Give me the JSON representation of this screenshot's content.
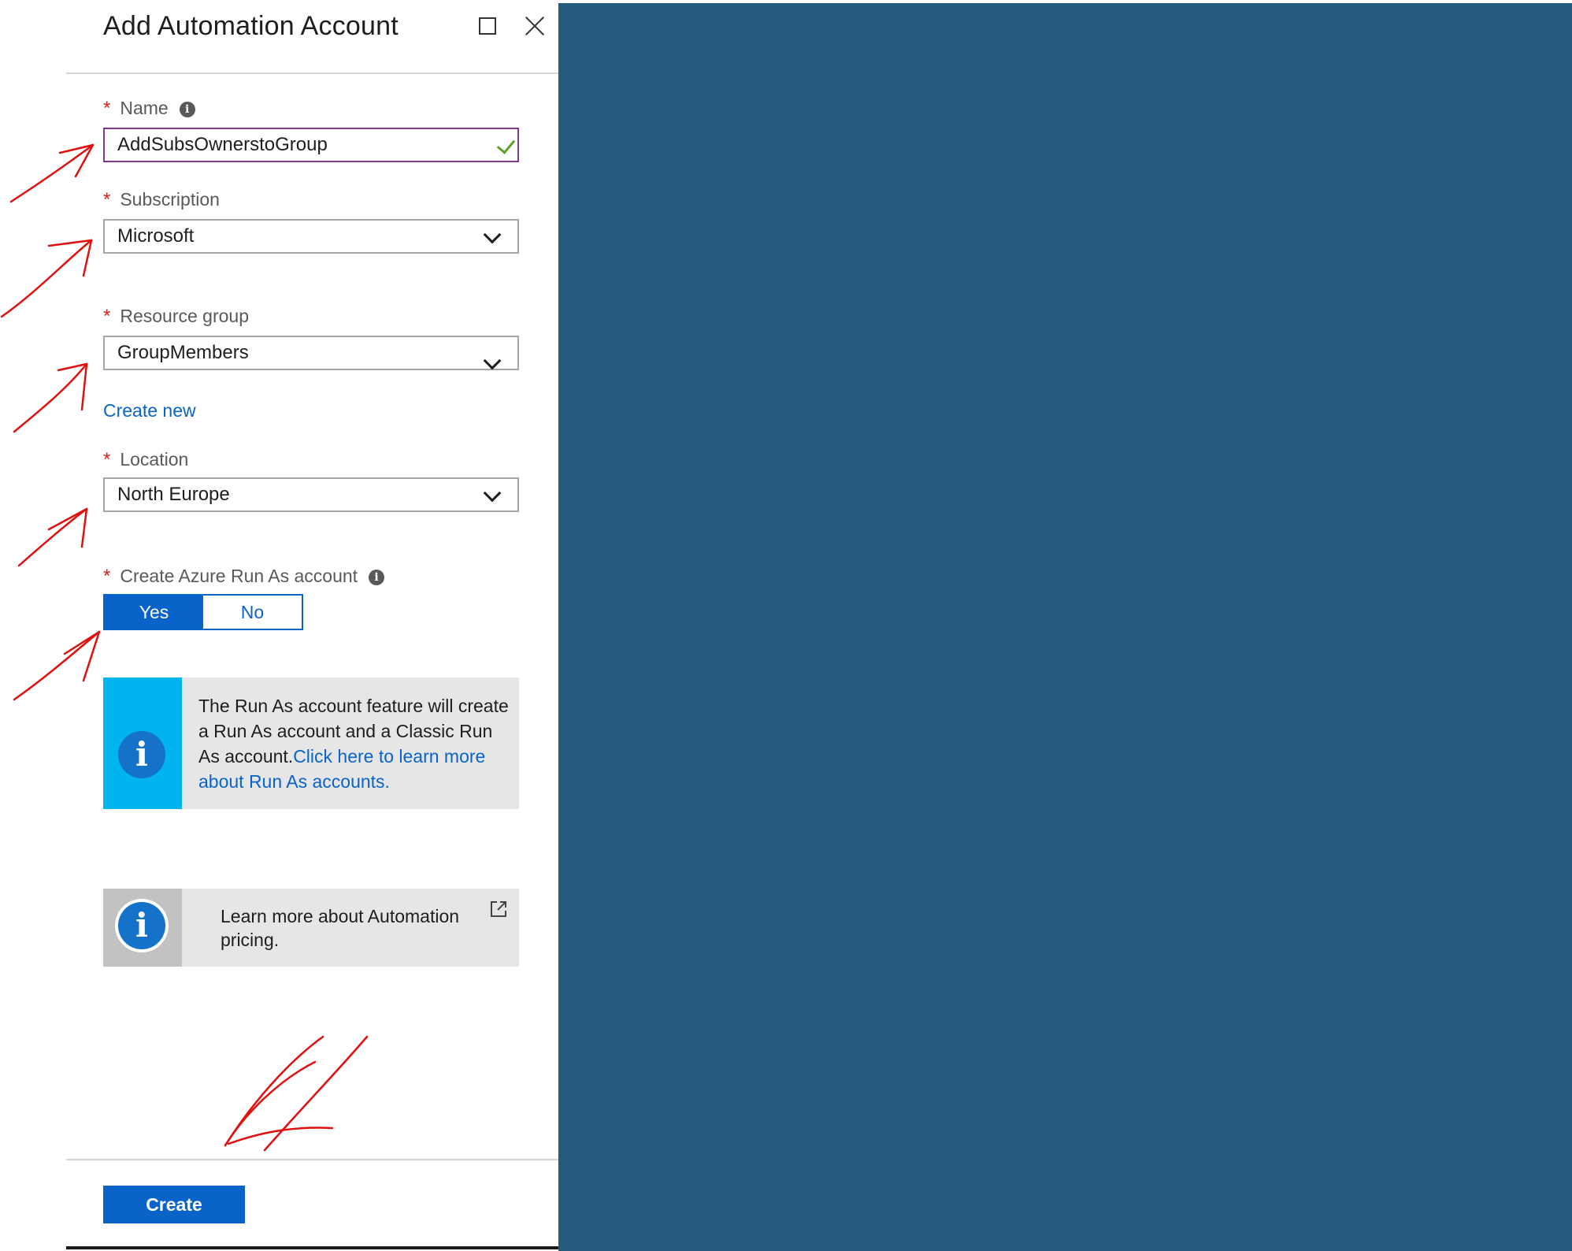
{
  "blade": {
    "title": "Add Automation Account",
    "maximize_icon": "maximize-icon",
    "close_icon": "close-icon"
  },
  "form": {
    "name": {
      "label": "Name",
      "value": "AddSubsOwnerstoGroup",
      "valid": true
    },
    "subscription": {
      "label": "Subscription",
      "value": "Microsoft"
    },
    "resource_group": {
      "label": "Resource group",
      "value": "GroupMembers",
      "create_new": "Create new"
    },
    "location": {
      "label": "Location",
      "value": "North Europe"
    },
    "run_as": {
      "label": "Create Azure Run As account",
      "options": [
        "Yes",
        "No"
      ],
      "selected": "Yes"
    }
  },
  "run_as_info": {
    "text": "The Run As account feature will create a Run As account and a Classic Run As account.",
    "link": "Click here to learn more about Run As accounts."
  },
  "pricing_info": {
    "text": "Learn more about Automation pricing."
  },
  "footer": {
    "create_label": "Create"
  },
  "colors": {
    "accent": "#0a63c9",
    "background_right": "#255b7d",
    "required_star": "#d61f1f",
    "annotation": "#e01010"
  }
}
